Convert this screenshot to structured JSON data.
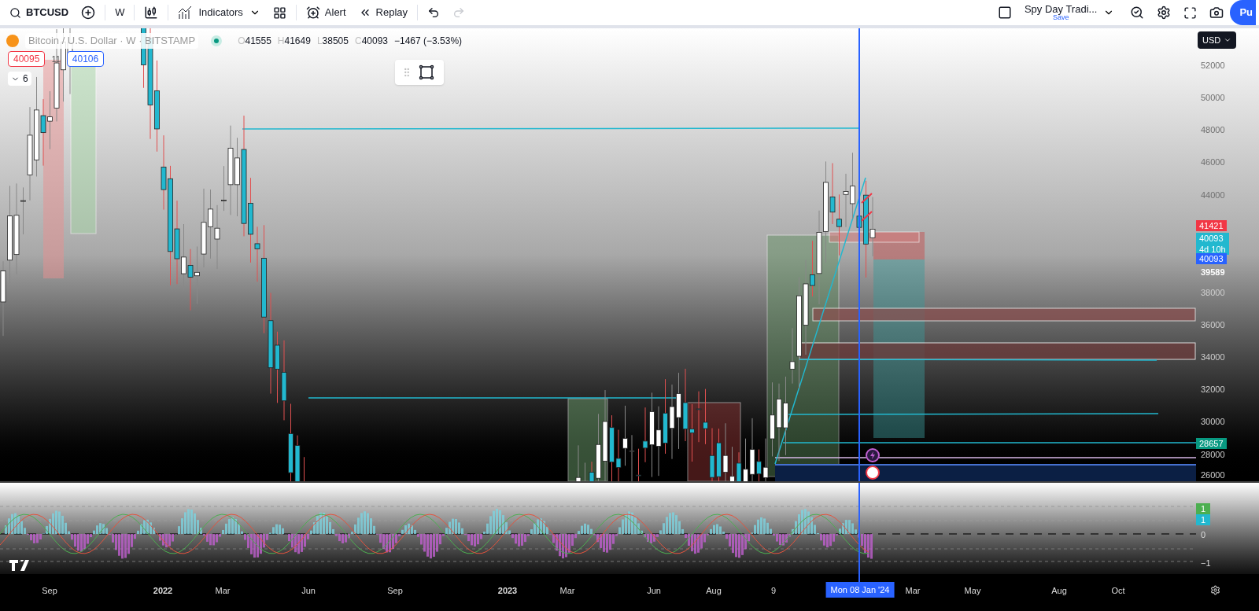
{
  "toolbar": {
    "symbol": "BTCUSD",
    "interval": "W",
    "indicators": "Indicators",
    "alert": "Alert",
    "replay": "Replay",
    "layout_name": "Spy Day Tradi...",
    "layout_status": "Save",
    "publish": "Pu"
  },
  "legend": {
    "title": "Bitcoin / U.S. Dollar · W · BITSTAMP",
    "market_open": true,
    "ohlc": [
      {
        "label": "O",
        "value": "41555"
      },
      {
        "label": "H",
        "value": "41649"
      },
      {
        "label": "L",
        "value": "38505"
      },
      {
        "label": "C",
        "value": "40093"
      }
    ],
    "change": "−1467 (−3.53%)"
  },
  "order": {
    "sell": "40095",
    "spread": "11",
    "buy": "40106"
  },
  "indicators_count": "6",
  "currency": "USD",
  "price_axis": [
    "52000",
    "50000",
    "48000",
    "46000",
    "44000",
    "38000",
    "36000",
    "34000",
    "32000",
    "30000",
    "28000",
    "26000"
  ],
  "price_badges": [
    {
      "kind": "badge",
      "lines": [
        "41421"
      ],
      "color": "#f23645"
    },
    {
      "kind": "badge",
      "lines": [
        "40093",
        "4d 10h"
      ],
      "color": "#22b8cf"
    },
    {
      "kind": "badge",
      "lines": [
        "40093"
      ],
      "color": "#2962ff"
    },
    {
      "kind": "plain",
      "lines": [
        "39589"
      ]
    },
    {
      "kind": "badge",
      "lines": [
        "28657"
      ],
      "color": "#089981"
    }
  ],
  "oscillator_axis": [
    {
      "kind": "badge",
      "text": "1",
      "color": "#4caf50"
    },
    {
      "kind": "badge",
      "text": "1",
      "color": "#22b8cf"
    },
    {
      "kind": "plain",
      "text": "0"
    },
    {
      "kind": "plain",
      "text": "−1"
    }
  ],
  "time_axis": [
    {
      "kind": "month",
      "text": "Sep"
    },
    {
      "kind": "year",
      "text": "2022"
    },
    {
      "kind": "month",
      "text": "Mar"
    },
    {
      "kind": "month",
      "text": "Jun"
    },
    {
      "kind": "month",
      "text": "Sep"
    },
    {
      "kind": "year",
      "text": "2023"
    },
    {
      "kind": "month",
      "text": "Mar"
    },
    {
      "kind": "month",
      "text": "Jun"
    },
    {
      "kind": "month",
      "text": "Aug"
    },
    {
      "kind": "month",
      "text": "9"
    },
    {
      "kind": "cursor",
      "text": "Mon 08 Jan '24"
    },
    {
      "kind": "month",
      "text": "Mar"
    },
    {
      "kind": "month",
      "text": "May"
    },
    {
      "kind": "month",
      "text": "Aug"
    },
    {
      "kind": "month",
      "text": "Oct"
    }
  ]
}
